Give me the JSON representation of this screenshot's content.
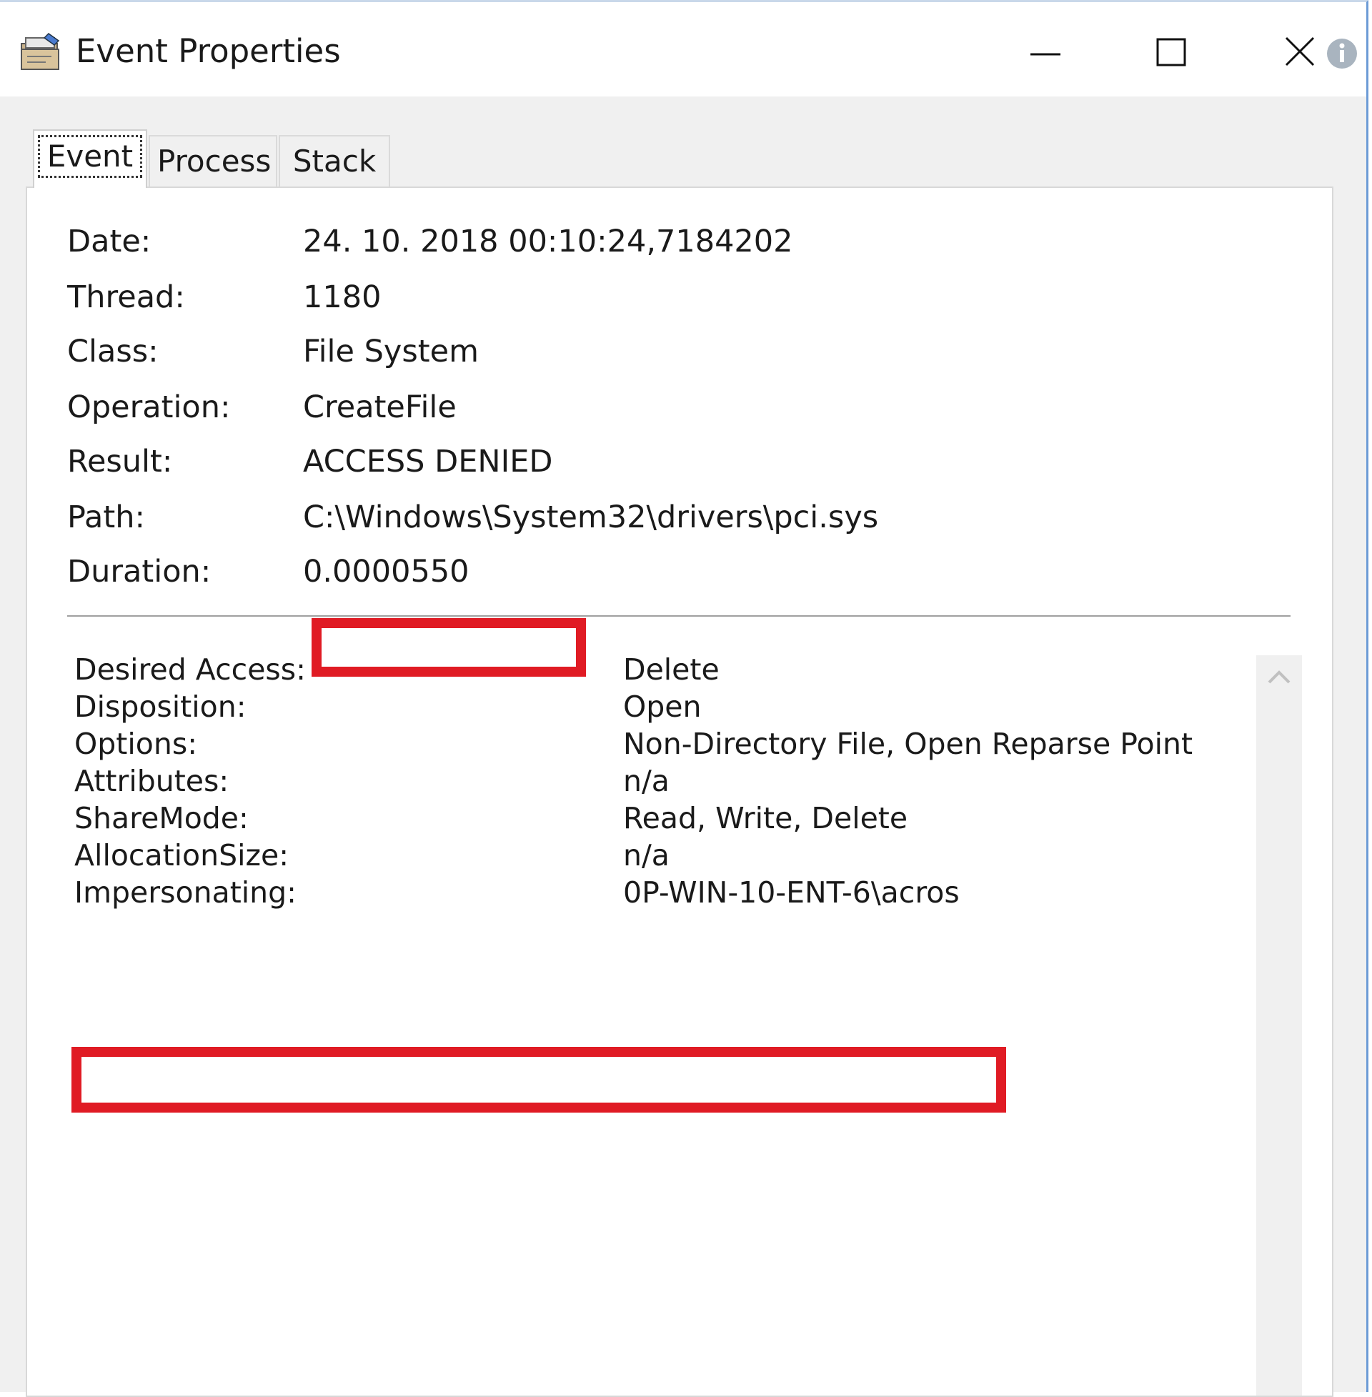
{
  "window": {
    "title": "Event Properties",
    "app_icon": "properties-window-icon",
    "controls": [
      "minimize-icon",
      "maximize-icon",
      "close-icon",
      "info-icon"
    ]
  },
  "tabs": [
    {
      "label": "Event",
      "active": true
    },
    {
      "label": "Process",
      "active": false
    },
    {
      "label": "Stack",
      "active": false
    }
  ],
  "event": {
    "date_label": "Date:",
    "date": "24. 10. 2018 00:10:24,7184202",
    "thread_label": "Thread:",
    "thread": "1180",
    "class_label": "Class:",
    "class": "File System",
    "operation_label": "Operation:",
    "operation": "CreateFile",
    "result_label": "Result:",
    "result": "ACCESS DENIED",
    "path_label": "Path:",
    "path": "C:\\Windows\\System32\\drivers\\pci.sys",
    "duration_label": "Duration:",
    "duration": "0.0000550"
  },
  "details": [
    {
      "label": "Desired Access:",
      "value": "Delete"
    },
    {
      "label": "Disposition:",
      "value": "Open"
    },
    {
      "label": "Options:",
      "value": "Non-Directory File, Open Reparse Point"
    },
    {
      "label": "Attributes:",
      "value": "n/a"
    },
    {
      "label": "ShareMode:",
      "value": "Read, Write, Delete"
    },
    {
      "label": "AllocationSize:",
      "value": "n/a"
    },
    {
      "label": "Impersonating:",
      "value": "0P-WIN-10-ENT-6\\acros"
    }
  ],
  "colors": {
    "highlight": "#e01b24",
    "accent": "#6c9bd6"
  }
}
